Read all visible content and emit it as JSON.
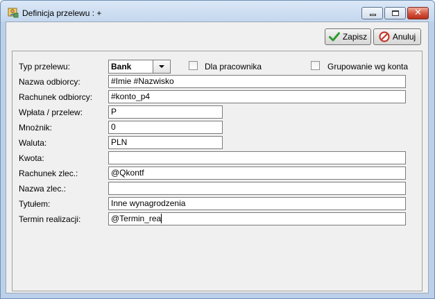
{
  "window": {
    "title": "Definicja przelewu : +"
  },
  "toolbar": {
    "save_label": "Zapisz",
    "cancel_label": "Anuluj"
  },
  "form": {
    "typ_przelewu": {
      "label": "Typ przelewu:",
      "value": "Bank"
    },
    "dla_pracownika": {
      "label": "Dla pracownika",
      "checked": false
    },
    "grupowanie": {
      "label": "Grupowanie wg konta",
      "checked": false
    },
    "nazwa_odbiorcy": {
      "label": "Nazwa odbiorcy:",
      "value": "#Imie #Nazwisko"
    },
    "rachunek_odbiorcy": {
      "label": "Rachunek odbiorcy:",
      "value": "#konto_p4"
    },
    "wplata_przelew": {
      "label": "Wpłata / przelew:",
      "value": "P"
    },
    "mnoznik": {
      "label": "Mnożnik:",
      "value": "0"
    },
    "waluta": {
      "label": "Waluta:",
      "value": "PLN"
    },
    "kwota": {
      "label": "Kwota:",
      "value": ""
    },
    "rachunek_zlec": {
      "label": "Rachunek zlec.:",
      "value": "@Qkontf"
    },
    "nazwa_zlec": {
      "label": "Nazwa zlec.:",
      "value": ""
    },
    "tytulem": {
      "label": "Tytułem:",
      "value": "Inne wynagrodzenia"
    },
    "termin_realizacji": {
      "label": "Termin realizacji:",
      "value": "@Termin_rea"
    }
  },
  "colors": {
    "title_bar": "#c4d7ee",
    "close_button": "#d2533d",
    "save_icon": "#2e9a2e",
    "cancel_icon": "#c0392b"
  }
}
